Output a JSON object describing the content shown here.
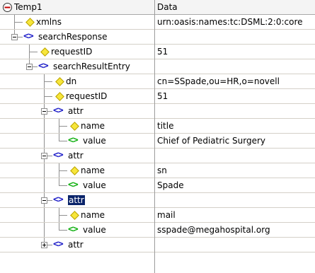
{
  "header": {
    "name_col": "Temp1",
    "data_col": "Data"
  },
  "rows": [
    {
      "depth": 0,
      "kind": "attribute",
      "name": "xmlns",
      "value": "urn:oasis:names:tc:DSML:2:0:core"
    },
    {
      "depth": 0,
      "kind": "element",
      "expander": "minus",
      "name": "searchResponse",
      "value": ""
    },
    {
      "depth": 1,
      "kind": "attribute",
      "name": "requestID",
      "value": "51"
    },
    {
      "depth": 1,
      "kind": "element",
      "expander": "minus",
      "name": "searchResultEntry",
      "value": ""
    },
    {
      "depth": 2,
      "kind": "attribute",
      "name": "dn",
      "value": "cn=SSpade,ou=HR,o=novell"
    },
    {
      "depth": 2,
      "kind": "attribute",
      "name": "requestID",
      "value": "51"
    },
    {
      "depth": 2,
      "kind": "element",
      "expander": "minus",
      "name": "attr",
      "value": ""
    },
    {
      "depth": 3,
      "kind": "attribute",
      "name": "name",
      "value": "title"
    },
    {
      "depth": 3,
      "kind": "text",
      "name": "value",
      "value": "Chief of Pediatric Surgery"
    },
    {
      "depth": 2,
      "kind": "element",
      "expander": "minus",
      "name": "attr",
      "value": ""
    },
    {
      "depth": 3,
      "kind": "attribute",
      "name": "name",
      "value": "sn"
    },
    {
      "depth": 3,
      "kind": "text",
      "name": "value",
      "value": "Spade"
    },
    {
      "depth": 2,
      "kind": "element",
      "expander": "minus",
      "name": "attr",
      "value": "",
      "selected": true
    },
    {
      "depth": 3,
      "kind": "attribute",
      "name": "name",
      "value": "mail"
    },
    {
      "depth": 3,
      "kind": "text",
      "name": "value",
      "value": "sspade@megahospital.org"
    },
    {
      "depth": 2,
      "kind": "element",
      "expander": "plus",
      "name": "attr",
      "value": ""
    }
  ],
  "icons": {
    "element": "element-tag-icon",
    "attribute": "attribute-diamond-icon",
    "text": "text-value-icon",
    "collapse": "collapse-icon",
    "expand": "expand-icon"
  },
  "colors": {
    "selection": "#0a246a",
    "element_icon": "#1e1ec8",
    "text_icon": "#10b010",
    "attr_icon": "#f7e63a"
  }
}
